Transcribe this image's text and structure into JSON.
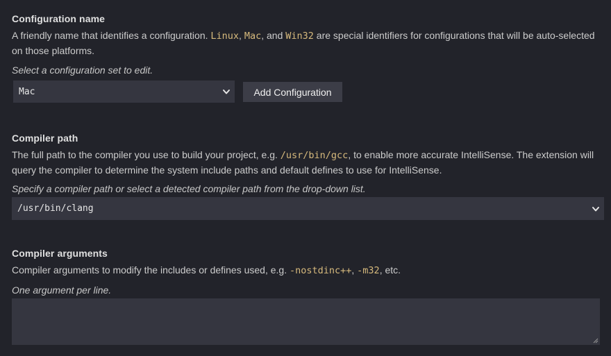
{
  "configuration_name": {
    "title": "Configuration name",
    "desc_before_linux": "A friendly name that identifies a configuration. ",
    "linux": "Linux",
    "comma1": ", ",
    "mac": "Mac",
    "and_text": ", and ",
    "win32": "Win32",
    "desc_after": " are special identifiers for configurations that will be auto-selected on those platforms.",
    "hint": "Select a configuration set to edit.",
    "selected_value": "Mac",
    "add_button_label": "Add Configuration"
  },
  "compiler_path": {
    "title": "Compiler path",
    "desc_before": "The full path to the compiler you use to build your project, e.g. ",
    "example_path": "/usr/bin/gcc",
    "desc_after": ", to enable more accurate IntelliSense. The extension will query the compiler to determine the system include paths and default defines to use for IntelliSense.",
    "hint": "Specify a compiler path or select a detected compiler path from the drop-down list.",
    "selected_value": "/usr/bin/clang"
  },
  "compiler_arguments": {
    "title": "Compiler arguments",
    "desc_before": "Compiler arguments to modify the includes or defines used, e.g. ",
    "arg1": "-nostdinc++",
    "comma": ", ",
    "arg2": "-m32",
    "desc_after": ", etc.",
    "hint": "One argument per line.",
    "value": ""
  },
  "icons": {
    "dropdown": "chevron-down-icon",
    "resize": "resize-grip-icon"
  },
  "colors": {
    "background": "#22232a",
    "input_background": "#353640",
    "button_background": "#3c3d47",
    "code_text": "#d7ba7d"
  }
}
